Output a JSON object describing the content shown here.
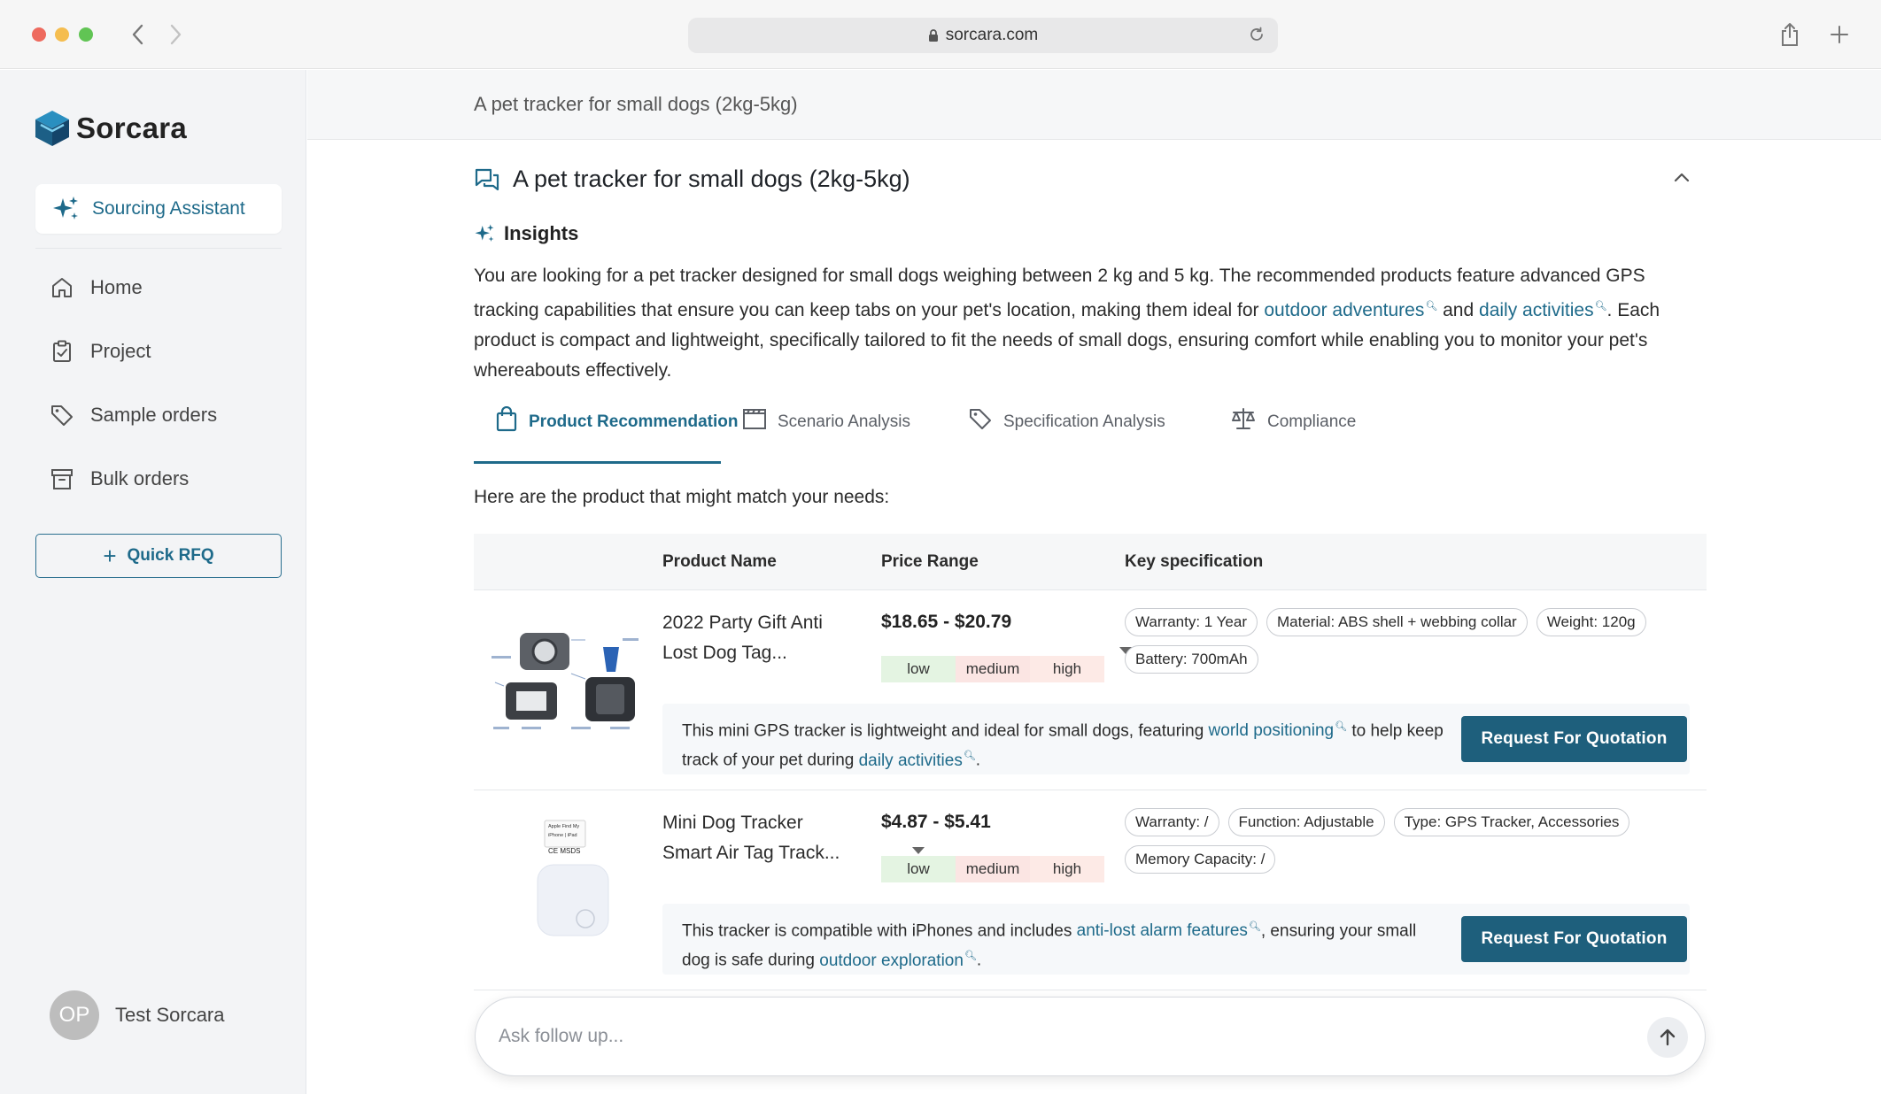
{
  "browser": {
    "url": "sorcara.com"
  },
  "sidebar": {
    "brand": "Sorcara",
    "assistant_label": "Sourcing Assistant",
    "items": [
      {
        "label": "Home",
        "icon": "home-icon"
      },
      {
        "label": "Project",
        "icon": "clipboard-icon"
      },
      {
        "label": "Sample orders",
        "icon": "tag-icon"
      },
      {
        "label": "Bulk orders",
        "icon": "archive-icon"
      }
    ],
    "quick_rfq": "Quick RFQ",
    "user": {
      "initials": "OP",
      "name": "Test Sorcara"
    }
  },
  "main": {
    "query": "A pet tracker for small dogs (2kg-5kg)",
    "thread_title": "A pet tracker for small dogs (2kg-5kg)",
    "insights_heading": "Insights",
    "insights": {
      "p1": "You are looking for a pet tracker designed for small dogs weighing between 2 kg and 5 kg. The recommended products feature advanced GPS tracking capabilities that ensure you can keep tabs on your pet's location, making them ideal for ",
      "link1": "outdoor adventures",
      "p2": " and ",
      "link2": "daily activities",
      "p3": ". Each product is compact and lightweight, specifically tailored to fit the needs of small dogs, ensuring comfort while enabling you to monitor your pet's whereabouts effectively."
    },
    "tabs": [
      {
        "label": "Product Recommendation",
        "active": true
      },
      {
        "label": "Scenario Analysis",
        "active": false
      },
      {
        "label": "Specification Analysis",
        "active": false
      },
      {
        "label": "Compliance",
        "active": false
      }
    ],
    "intro": "Here are the product that might match your needs:",
    "table": {
      "headers": [
        "Product Name",
        "Price Range",
        "Key specification"
      ],
      "range_labels": [
        "low",
        "medium",
        "high"
      ],
      "rows": [
        {
          "name": "2022 Party Gift Anti Lost Dog Tag...",
          "price": "$18.65 - $20.79",
          "price_level": "high",
          "specs": [
            "Warranty: 1 Year",
            "Material: ABS shell + webbing collar",
            "Weight: 120g",
            "Battery: 700mAh"
          ],
          "desc_a": "This mini GPS tracker is lightweight and ideal for small dogs, featuring ",
          "desc_link1": "world positioning",
          "desc_b": " to help keep track of your pet during ",
          "desc_link2": "daily activities",
          "desc_c": ".",
          "cta": "Request For Quotation"
        },
        {
          "name": "Mini Dog Tracker Smart Air Tag Track...",
          "price": "$4.87 - $5.41",
          "price_level": "low",
          "specs": [
            "Warranty: /",
            "Function: Adjustable",
            "Type: GPS Tracker, Accessories",
            "Memory Capacity: /"
          ],
          "desc_a": "This tracker is compatible with iPhones and includes ",
          "desc_link1": "anti-lost alarm features",
          "desc_b": ", ensuring your small dog is safe during ",
          "desc_link2": "outdoor exploration",
          "desc_c": ".",
          "cta": "Request For Quotation",
          "thumb_text": [
            "Apple Find My",
            "iPhone | iPad",
            "CE  MSDS"
          ]
        }
      ]
    },
    "composer": {
      "placeholder": "Ask follow up..."
    }
  },
  "colors": {
    "accent": "#1e6a8a",
    "button": "#1e5f7c",
    "low": "#e4f4e2",
    "medium": "#fbe5e3",
    "high": "#fdeae6"
  }
}
